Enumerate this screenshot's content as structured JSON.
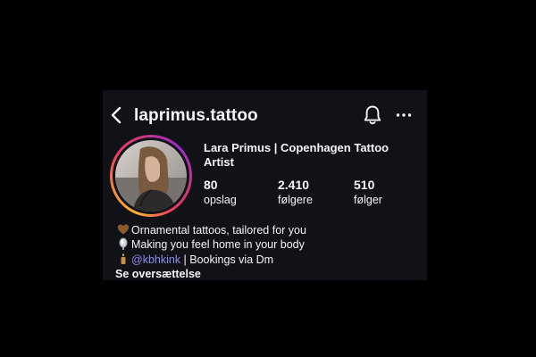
{
  "header": {
    "username": "laprimus.tattoo",
    "icons": [
      "back-chevron-icon",
      "bell-icon",
      "more-horizontal-icon"
    ]
  },
  "profile": {
    "display_name": "Lara Primus | Copenhagen Tattoo Artist",
    "stats": [
      {
        "value": "80",
        "label": "opslag"
      },
      {
        "value": "2.410",
        "label": "følgere"
      },
      {
        "value": "510",
        "label": "følger"
      }
    ]
  },
  "bio": {
    "line1": "Ornamental tattoos, tailored for you",
    "line2": "Making you feel home in your body",
    "line3_mention": "@kbhkink",
    "line3_rest": " | Bookings via Dm",
    "translate_label": "Se oversættelse"
  },
  "colors": {
    "background": "#000000",
    "panel": "#101217",
    "text": "#f5f5f5",
    "mention": "#8a8cf0",
    "story_ring": [
      "#f9b233",
      "#ef3d5f",
      "#c13584",
      "#a12bd0"
    ]
  }
}
